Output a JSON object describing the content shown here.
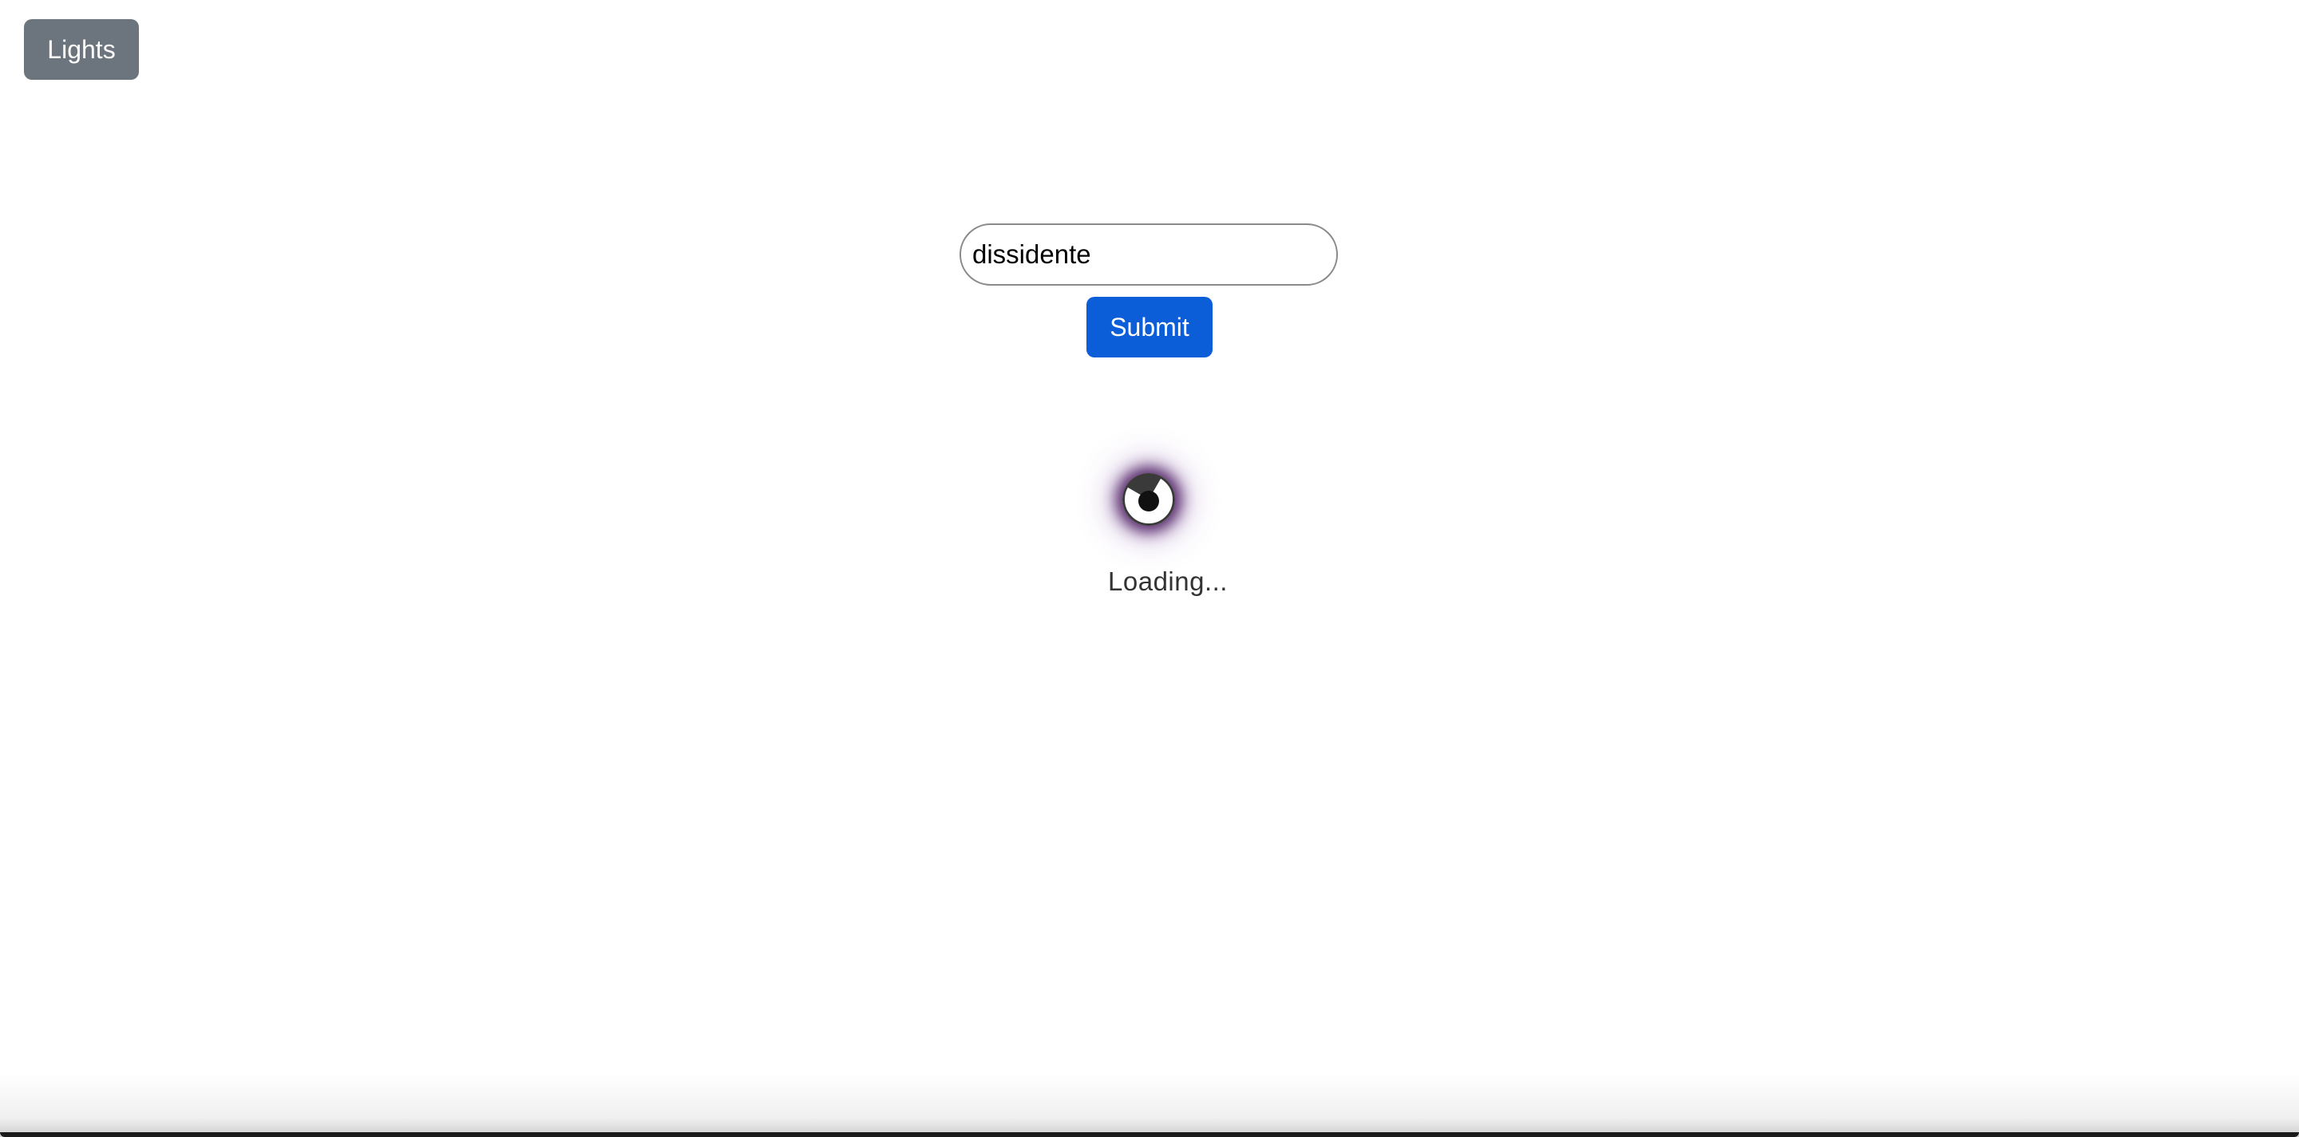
{
  "header": {
    "lights_label": "Lights"
  },
  "search": {
    "value": "dissidente",
    "placeholder": ""
  },
  "form": {
    "submit_label": "Submit"
  },
  "status": {
    "loading_text": "Loading...",
    "spinner_icon": "spinner-eye-icon"
  },
  "colors": {
    "lights_button_bg": "#6c757d",
    "submit_button_bg": "#0b5ed7",
    "spinner_glow": "#3c0a50"
  }
}
